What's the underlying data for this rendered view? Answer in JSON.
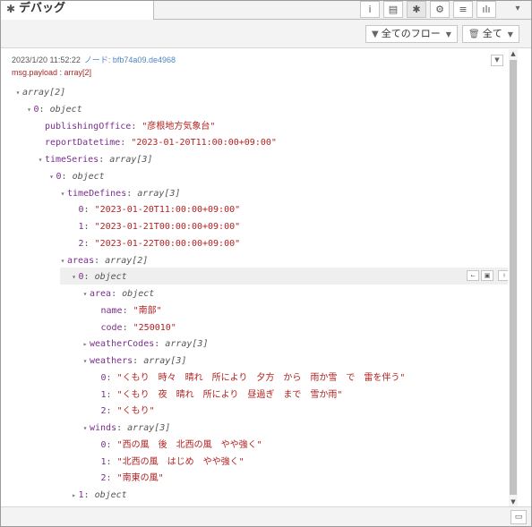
{
  "header": {
    "tab_label": "デバッグ",
    "tab_icon": "bug-icon",
    "buttons": [
      {
        "name": "info-tab-button",
        "glyph": "i"
      },
      {
        "name": "help-tab-button",
        "glyph": "▤"
      },
      {
        "name": "debug-tab-button",
        "glyph": "✱"
      },
      {
        "name": "config-tab-button",
        "glyph": "⚙"
      },
      {
        "name": "context-tab-button",
        "glyph": "≡"
      },
      {
        "name": "dashboard-tab-button",
        "glyph": "ılı"
      }
    ],
    "menu_glyph": "▾"
  },
  "toolbar": {
    "filter_label": "全てのフロー",
    "clear_label": "全て"
  },
  "message": {
    "timestamp": "2023/1/20 11:52:22",
    "node_label": "ノード: bfb74a09.de4968",
    "topic": "msg.payload : array[2]"
  },
  "tree": [
    {
      "tw": "▾",
      "k": "",
      "t": "array[2]",
      "v": ""
    },
    {
      "tw": "▾",
      "k": "0",
      "t": "object",
      "v": ""
    },
    {
      "tw": "",
      "k": "publishingOffice",
      "t": "",
      "v": "\"彦根地方気象台\""
    },
    {
      "tw": "",
      "k": "reportDatetime",
      "t": "",
      "v": "\"2023-01-20T11:00:00+09:00\""
    },
    {
      "tw": "▾",
      "k": "timeSeries",
      "t": "array[3]",
      "v": ""
    },
    {
      "tw": "▾",
      "k": "0",
      "t": "object",
      "v": ""
    },
    {
      "tw": "▾",
      "k": "timeDefines",
      "t": "array[3]",
      "v": ""
    },
    {
      "tw": "",
      "k": "0",
      "t": "",
      "v": "\"2023-01-20T11:00:00+09:00\""
    },
    {
      "tw": "",
      "k": "1",
      "t": "",
      "v": "\"2023-01-21T00:00:00+09:00\""
    },
    {
      "tw": "",
      "k": "2",
      "t": "",
      "v": "\"2023-01-22T00:00:00+09:00\""
    },
    {
      "tw": "▾",
      "k": "areas",
      "t": "array[2]",
      "v": ""
    },
    {
      "tw": "▾",
      "k": "0",
      "t": "object",
      "v": ""
    },
    {
      "tw": "▾",
      "k": "area",
      "t": "object",
      "v": ""
    },
    {
      "tw": "",
      "k": "name",
      "t": "",
      "v": "\"南部\""
    },
    {
      "tw": "",
      "k": "code",
      "t": "",
      "v": "\"250010\""
    },
    {
      "tw": "▸",
      "k": "weatherCodes",
      "t": "array[3]",
      "v": ""
    },
    {
      "tw": "▾",
      "k": "weathers",
      "t": "array[3]",
      "v": ""
    },
    {
      "tw": "",
      "k": "0",
      "t": "",
      "v": "\"くもり　時々　晴れ　所により　夕方　から　雨か雪　で　雷を伴う\""
    },
    {
      "tw": "",
      "k": "1",
      "t": "",
      "v": "\"くもり　夜　晴れ　所により　昼過ぎ　まで　雪か雨\""
    },
    {
      "tw": "",
      "k": "2",
      "t": "",
      "v": "\"くもり\""
    },
    {
      "tw": "▾",
      "k": "winds",
      "t": "array[3]",
      "v": ""
    },
    {
      "tw": "",
      "k": "0",
      "t": "",
      "v": "\"西の風　後　北西の風　やや強く\""
    },
    {
      "tw": "",
      "k": "1",
      "t": "",
      "v": "\"北西の風　はじめ　やや強く\""
    },
    {
      "tw": "",
      "k": "2",
      "t": "",
      "v": "\"南東の風\""
    },
    {
      "tw": "▸",
      "k": "1",
      "t": "object",
      "v": ""
    }
  ],
  "row_tools": [
    "⌙",
    "▣",
    "⍿"
  ],
  "footer_icon": "monitor-icon"
}
